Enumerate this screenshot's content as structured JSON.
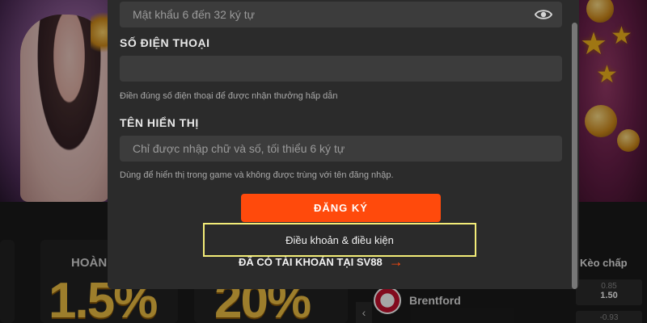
{
  "form": {
    "password": {
      "placeholder": "Mật khẩu 6 đến 32 ký tự",
      "value": ""
    },
    "phone": {
      "label": "SỐ ĐIỆN THOẠI",
      "value": "",
      "hint": "Điền đúng số điện thoại để được nhận thưởng hấp dẫn"
    },
    "display_name": {
      "label": "TÊN HIỂN THỊ",
      "placeholder": "Chỉ được nhập chữ và số, tối thiểu 6 ký tự",
      "value": "",
      "hint": "Dùng để hiển thị trong game và không được trùng với tên đăng nhập."
    },
    "register_label": "ĐĂNG KÝ",
    "terms_label": "Điều khoản & điều kiện",
    "login_link": "ĐÃ CÓ TÀI KHOẢN TẠI SV88",
    "login_arrow": "→"
  },
  "background": {
    "promo1": {
      "label": "HOÀN",
      "big": "1.5%"
    },
    "promo2": {
      "big": "20%"
    },
    "team": {
      "name": "Brentford"
    },
    "slider_prev": "‹",
    "odds": {
      "header": "Kèo chấp",
      "row1": {
        "handicap": "0.85",
        "value": "1.50"
      },
      "row2": {
        "handicap": "-0.93"
      }
    }
  },
  "colors": {
    "accent": "#ff4a0c",
    "highlight_border": "#f3ec78",
    "modal_bg": "#2b2b2b",
    "field_bg": "#3c3c3c"
  },
  "icons": {
    "password_toggle": "eye-icon",
    "login_arrow": "arrow-right-icon",
    "prev": "chevron-left-icon"
  }
}
